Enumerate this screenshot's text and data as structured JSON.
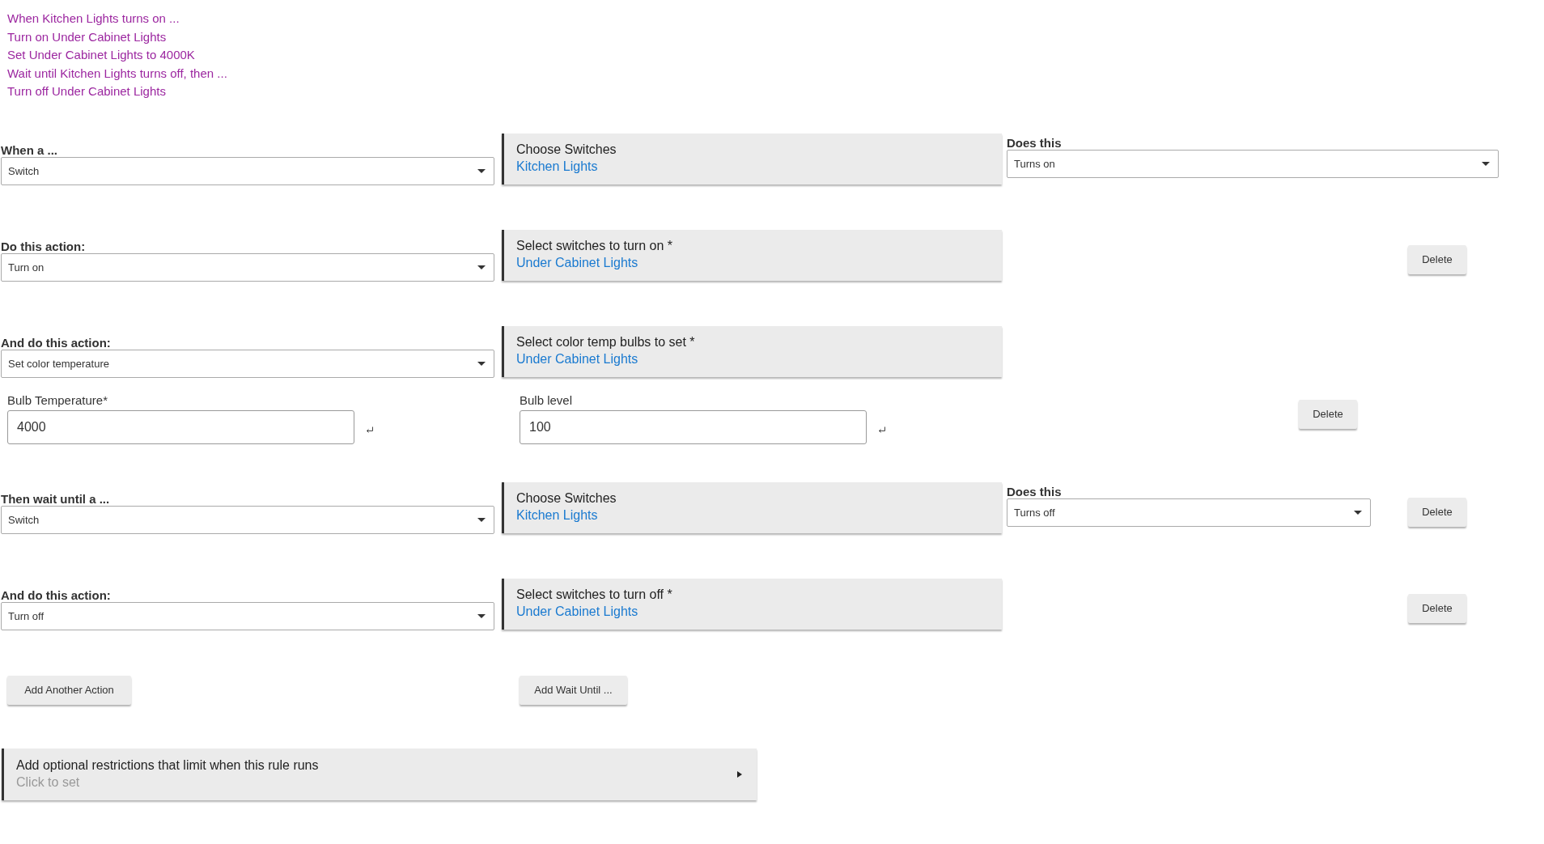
{
  "summary": [
    "When Kitchen Lights turns on ...",
    "Turn on Under Cabinet Lights",
    "Set Under Cabinet Lights to 4000K",
    "Wait until Kitchen Lights turns off, then ...",
    "Turn off Under Cabinet Lights"
  ],
  "rows": [
    {
      "kind": "select",
      "label": "When a ...",
      "value": "Switch",
      "panel": {
        "title": "Choose Switches",
        "value": "Kitchen Lights"
      },
      "does_this": {
        "label": "Does this",
        "value": "Turns on"
      }
    },
    {
      "kind": "select",
      "label": "Do this action:",
      "value": "Turn on",
      "panel": {
        "title": "Select switches to turn on *",
        "value": "Under Cabinet Lights"
      },
      "delete": "Delete"
    },
    {
      "kind": "select",
      "label": "And do this action:",
      "value": "Set color temperature",
      "panel": {
        "title": "Select color temp bulbs to set *",
        "value": "Under Cabinet Lights"
      }
    },
    {
      "kind": "inputs",
      "fields": [
        {
          "label": "Bulb Temperature*",
          "value": "4000"
        },
        {
          "label": "Bulb level",
          "value": "100"
        }
      ],
      "delete": "Delete"
    },
    {
      "kind": "select",
      "label": "Then wait until a ...",
      "value": "Switch",
      "panel": {
        "title": "Choose Switches",
        "value": "Kitchen Lights"
      },
      "does_this": {
        "label": "Does this",
        "value": "Turns off"
      },
      "delete": "Delete"
    },
    {
      "kind": "select",
      "label": "And do this action:",
      "value": "Turn off",
      "panel": {
        "title": "Select switches to turn off *",
        "value": "Under Cabinet Lights"
      },
      "delete": "Delete"
    }
  ],
  "buttons": [
    "Add Another Action",
    "Add Wait Until ..."
  ],
  "restrictions": {
    "title": "Add optional restrictions that limit when this rule runs",
    "hint": "Click to set"
  }
}
